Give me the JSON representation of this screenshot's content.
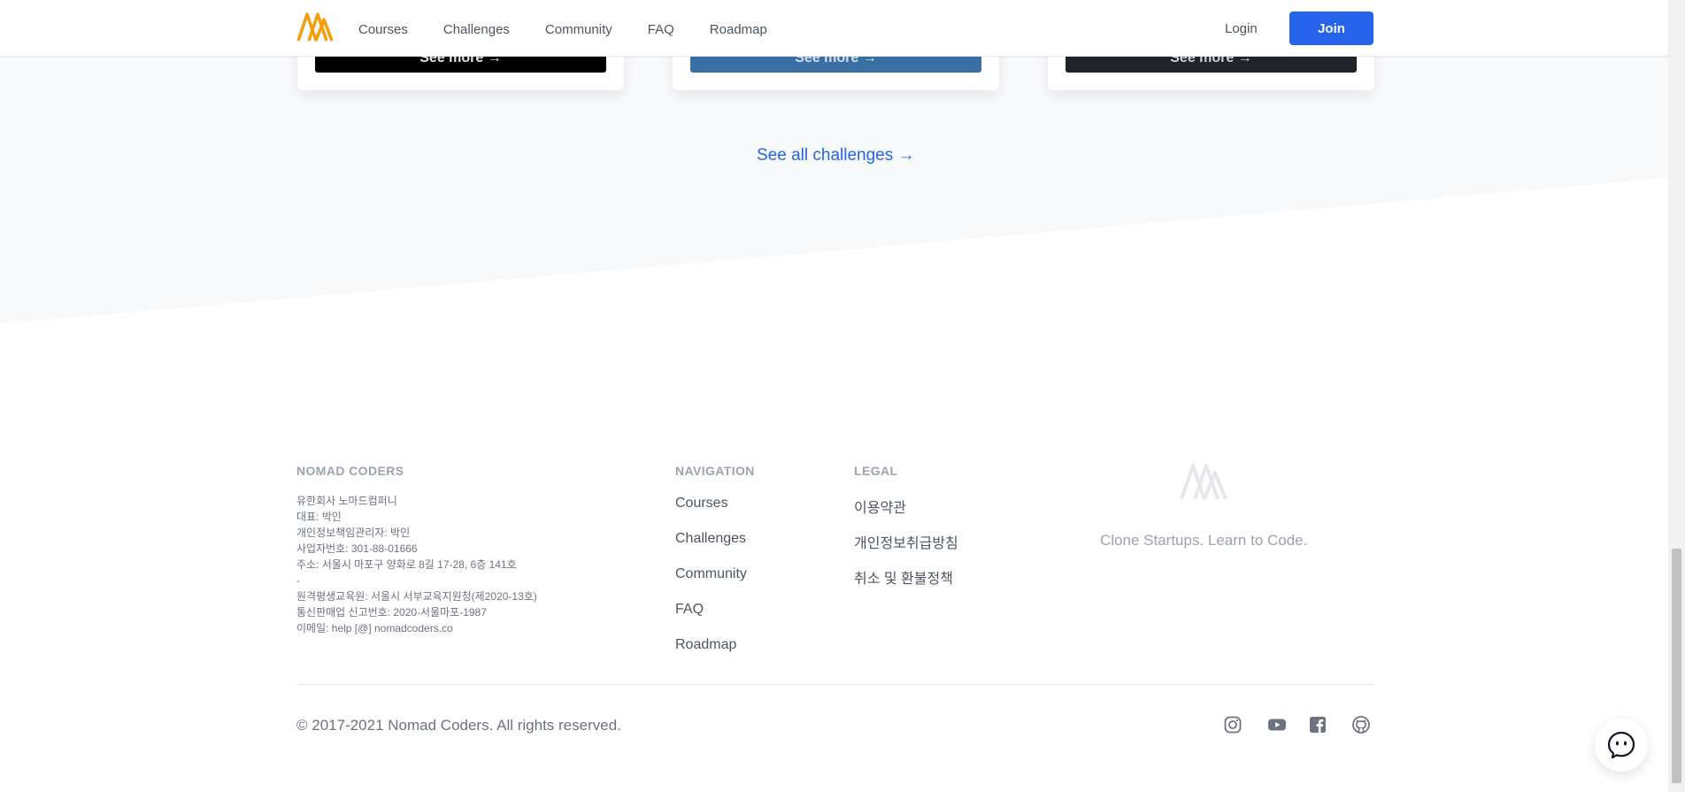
{
  "header": {
    "nav": [
      "Courses",
      "Challenges",
      "Community",
      "FAQ",
      "Roadmap"
    ],
    "login": "Login",
    "join": "Join"
  },
  "cards": {
    "see_more": "See more →"
  },
  "see_all": "See all challenges →",
  "footer": {
    "company_heading": "NOMAD CODERS",
    "company_lines": [
      "유한회사 노마드컴퍼니",
      "대표: 박인",
      "개인정보책임관리자: 박인",
      "사업자번호: 301-88-01666",
      "주소: 서울시 마포구 양화로 8길 17-28, 6층 141호",
      "-",
      "원격평생교육원: 서울시 서부교육지원청(제2020-13호)",
      "통신판매업 신고번호: 2020-서울마포-1987",
      "이메일: help [@] nomadcoders.co"
    ],
    "navigation_heading": "NAVIGATION",
    "navigation": [
      "Courses",
      "Challenges",
      "Community",
      "FAQ",
      "Roadmap"
    ],
    "legal_heading": "LEGAL",
    "legal": [
      "이용약관",
      "개인정보취급방침",
      "취소 및 환불정책"
    ],
    "tagline": "Clone Startups. Learn to Code.",
    "copyright": "© 2017-2021 Nomad Coders. All rights reserved.",
    "social": [
      "instagram-icon",
      "youtube-icon",
      "facebook-icon",
      "github-icon"
    ]
  },
  "colors": {
    "accent": "#2563eb",
    "logo_orange": "#f59e0b",
    "muted": "#9ca3af"
  }
}
